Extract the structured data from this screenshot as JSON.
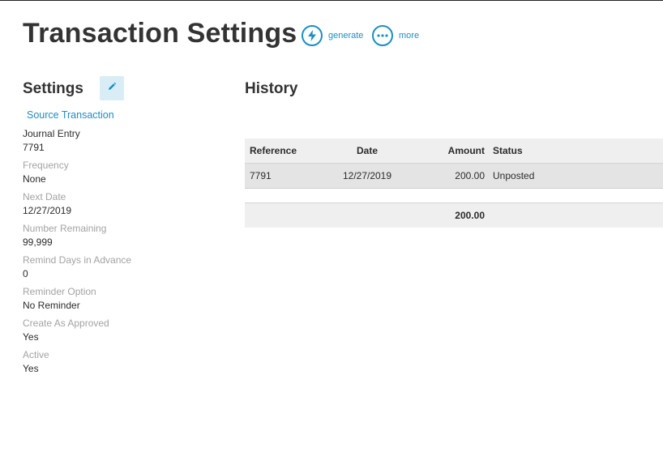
{
  "header": {
    "title": "Transaction Settings",
    "actions": [
      {
        "label": "generate",
        "icon": "lightning-icon"
      },
      {
        "label": "more",
        "icon": "more-icon"
      }
    ]
  },
  "settings": {
    "heading": "Settings",
    "source_link": "Source Transaction",
    "fields": [
      {
        "label": "Journal Entry",
        "value": "7791"
      },
      {
        "label": "Frequency",
        "value": "None"
      },
      {
        "label": "Next Date",
        "value": "12/27/2019"
      },
      {
        "label": "Number Remaining",
        "value": "99,999"
      },
      {
        "label": "Remind Days in Advance",
        "value": "0"
      },
      {
        "label": "Reminder Option",
        "value": "No Reminder"
      },
      {
        "label": "Create As Approved",
        "value": "Yes"
      },
      {
        "label": "Active",
        "value": "Yes"
      }
    ]
  },
  "history": {
    "heading": "History",
    "columns": [
      "Reference",
      "Date",
      "Amount",
      "Status"
    ],
    "rows": [
      {
        "reference": "7791",
        "date": "12/27/2019",
        "amount": "200.00",
        "status": "Unposted"
      }
    ],
    "total": "200.00"
  },
  "colors": {
    "accent": "#1a8fc4",
    "edit_bg": "#d9edf7",
    "muted_label": "#a3a3a3"
  }
}
